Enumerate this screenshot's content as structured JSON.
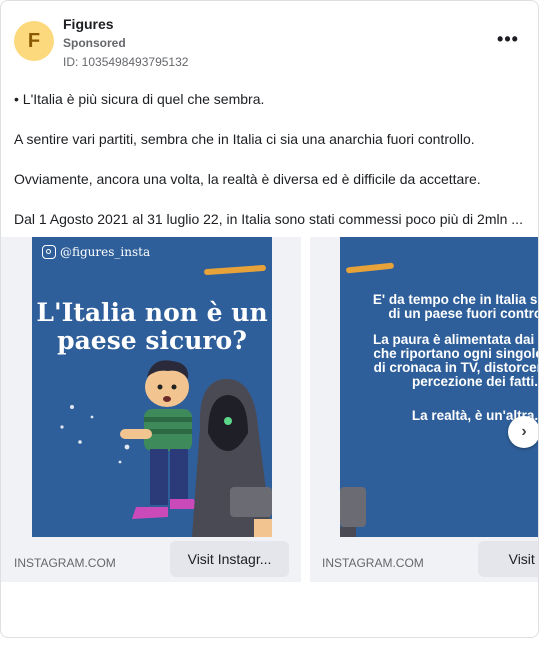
{
  "advertiser": {
    "name": "Figures",
    "avatar_letter": "F",
    "sponsored_label": "Sponsored",
    "ad_id": "ID: 1035498493795132"
  },
  "more_icon": "more-horizontal-icon",
  "body_lines": [
    "• L'Italia è più sicura di quel che sembra.",
    "A sentire vari partiti, sembra che in Italia ci sia una anarchia fuori controllo.",
    "Ovviamente, ancora una volta, la realtà è diversa ed è difficile da accettare.",
    "Dal 1 Agosto 2021 al 31 luglio 22, in Italia sono stati commessi poco più di 2mln ..."
  ],
  "cards": [
    {
      "handle": "@figures_insta",
      "headline": "L'Italia non è un paese sicuro?",
      "domain": "INSTAGRAM.COM",
      "cta": "Visit Instagr..."
    },
    {
      "paragraphs": [
        "E' da tempo che in Italia si parla di un paese fuori controllo.",
        "La paura è alimentata dai media che riportano ogni singolo fatto di cronaca in TV, distorcendo la percezione dei fatti.",
        "La realtà, è un'altra."
      ],
      "domain": "INSTAGRAM.COM",
      "cta": "Visit Ins"
    }
  ],
  "colors": {
    "slide_background": "#2f5f9a",
    "accent_brush": "#e7a33a",
    "avatar": "#fcd97c"
  }
}
